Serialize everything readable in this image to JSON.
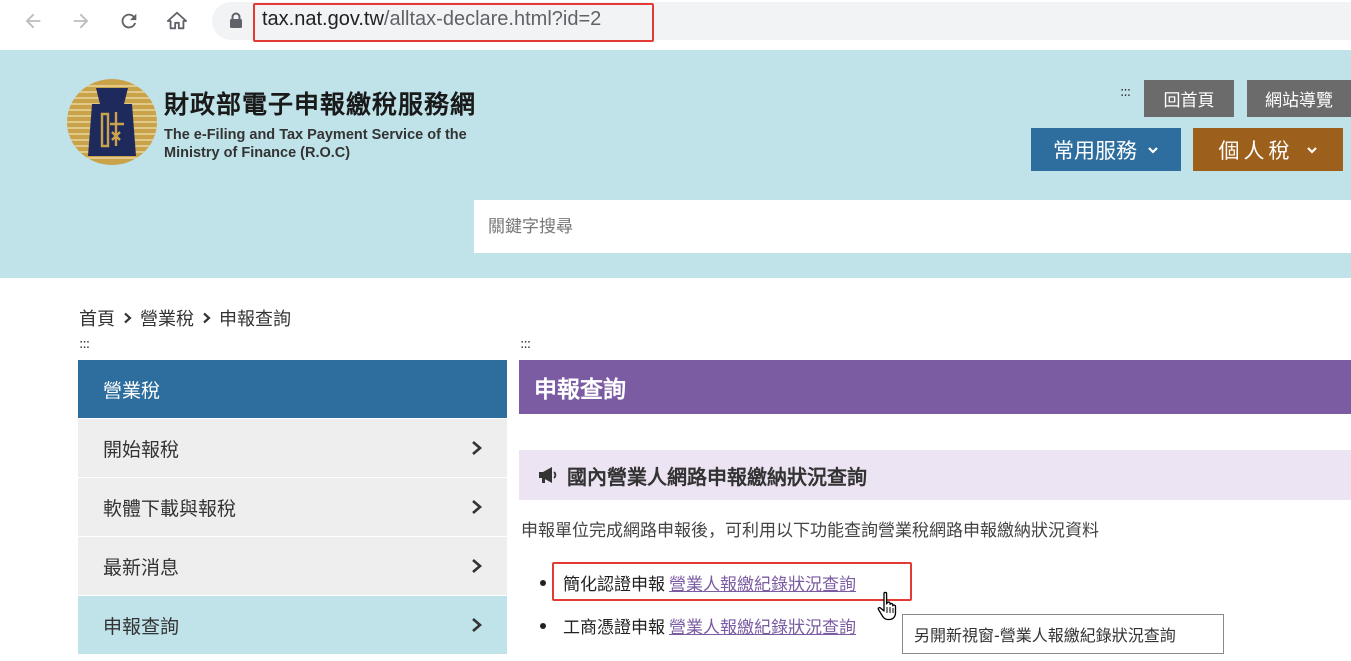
{
  "browser": {
    "url_host": "tax.nat.gov.tw",
    "url_path": "/alltax-declare.html?id=2"
  },
  "header": {
    "title": "財政部電子申報繳稅服務網",
    "subtitle_line1": "The e-Filing and Tax Payment Service of the",
    "subtitle_line2": "Ministry of Finance (R.O.C)",
    "accesskey": ":::",
    "home_label": "回首頁",
    "sitemap_label": "網站導覽",
    "services_label": "常用服務",
    "personal_label": "個人稅",
    "search_placeholder": "關鍵字搜尋"
  },
  "breadcrumb": [
    "首頁",
    "營業稅",
    "申報查詢"
  ],
  "sidebar": {
    "accesskey": ":::",
    "heading": "營業稅",
    "items": [
      {
        "label": "開始報稅"
      },
      {
        "label": "軟體下載與報稅"
      },
      {
        "label": "最新消息"
      },
      {
        "label": "申報查詢"
      }
    ]
  },
  "main": {
    "accesskey": ":::",
    "title": "申報查詢",
    "section_title": "國內營業人網路申報繳納狀況查詢",
    "description": "申報單位完成網路申報後，可利用以下功能查詢營業稅網路申報繳納狀況資料",
    "list": [
      {
        "prefix": "簡化認證申報",
        "link": "營業人報繳紀錄狀況查詢"
      },
      {
        "prefix": "工商憑證申報",
        "link": "營業人報繳紀錄狀況查詢"
      }
    ],
    "tooltip": "另開新視窗-營業人報繳紀錄狀況查詢"
  },
  "colors": {
    "header_bg": "#bfe3e9",
    "sidebar_head": "#2e6e9e",
    "main_title": "#7b5ca3",
    "section_bg": "#ede4f3",
    "personal_btn": "#9c5f1c",
    "highlight": "#e53935"
  },
  "icons": [
    "back-arrow-icon",
    "forward-arrow-icon",
    "reload-icon",
    "home-icon",
    "lock-icon",
    "chevron-down-icon",
    "chevron-right-icon",
    "megaphone-icon",
    "hand-cursor-icon"
  ]
}
